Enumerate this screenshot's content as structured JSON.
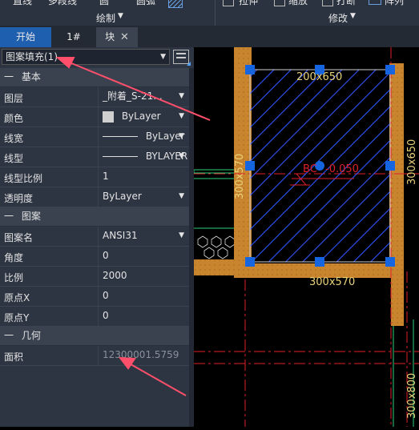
{
  "ribbon": {
    "line_label": "直线",
    "polyline_label": "多段线",
    "circle_label": "圆",
    "arc_label": "圆弧",
    "draw_group": "绘制",
    "stretch_label": "拉伸",
    "scale_label": "缩放",
    "break_label": "打断",
    "array_label": "阵列",
    "modify_group": "修改"
  },
  "tabs": [
    {
      "label": "开始"
    },
    {
      "label": "1#"
    },
    {
      "label": "块"
    }
  ],
  "panel": {
    "selection": "图案填充(1)",
    "sections": {
      "basic": "基本",
      "pattern": "图案",
      "geometry": "几何"
    },
    "section_prefix": "一",
    "rows": [
      {
        "label": "图层",
        "value": "_附着_S-21..."
      },
      {
        "label": "颜色",
        "value": "ByLayer"
      },
      {
        "label": "线宽",
        "value": "ByLayer"
      },
      {
        "label": "线型",
        "value": "BYLAYER"
      },
      {
        "label": "线型比例",
        "value": "1"
      },
      {
        "label": "透明度",
        "value": "ByLayer"
      },
      {
        "label": "图案名",
        "value": "ANSI31"
      },
      {
        "label": "角度",
        "value": "0"
      },
      {
        "label": "比例",
        "value": "2000"
      },
      {
        "label": "原点X",
        "value": "0"
      },
      {
        "label": "原点Y",
        "value": "0"
      },
      {
        "label": "面积",
        "value": "12300001.5759"
      }
    ]
  },
  "drawing": {
    "beam_top": "200x650",
    "beam_left": "300x570",
    "beam_bottom": "300x570",
    "beam_right": "300x650",
    "beam_right_bottom": "300x800",
    "bc_label": "BC",
    "elevation": "-0.050"
  },
  "colors": {
    "accent_blue": "#1565e0",
    "hatch_blue": "#2f55ff",
    "beam_orange": "#c9852e",
    "annotation_yellow": "#e8d27a",
    "red_line": "#e0202a",
    "green_line": "#2bd17a",
    "arrow_pink": "#ff4f6a"
  }
}
